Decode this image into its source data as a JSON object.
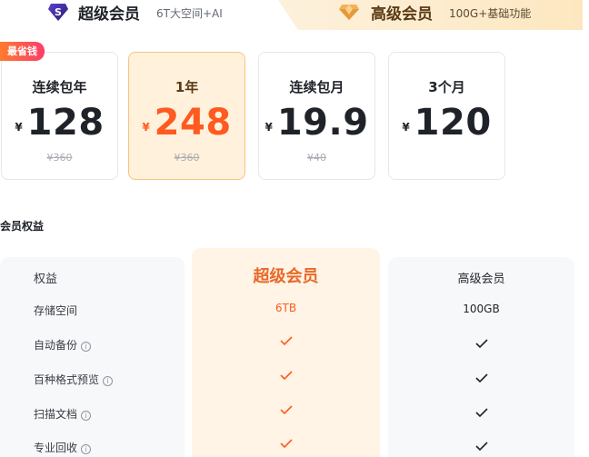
{
  "tabs": {
    "super": {
      "title": "超级会员",
      "subtitle": "6T大空间+AI",
      "icon": "super-member-s-icon"
    },
    "high": {
      "title": "高级会员",
      "subtitle": "100G+基础功能",
      "icon": "diamond-icon"
    }
  },
  "plans": [
    {
      "name": "连续包年",
      "currency": "¥",
      "price": "128",
      "original": "¥360",
      "badge": "最省钱",
      "selected": false
    },
    {
      "name": "1年",
      "currency": "¥",
      "price": "248",
      "original": "¥360",
      "selected": true
    },
    {
      "name": "连续包月",
      "currency": "¥",
      "price": "19.9",
      "original": "¥40",
      "selected": false
    },
    {
      "name": "3个月",
      "currency": "¥",
      "price": "120",
      "original": "",
      "selected": false
    }
  ],
  "benefits": {
    "section_title": "会员权益",
    "header": {
      "label": "权益",
      "super": "超级会员",
      "high": "高级会员"
    },
    "rows": [
      {
        "label": "存储空间",
        "info": false,
        "super": "6TB",
        "high": "100GB"
      },
      {
        "label": "自动备份",
        "info": true,
        "super": "check",
        "high": "check"
      },
      {
        "label": "百种格式预览",
        "info": true,
        "super": "check",
        "high": "check"
      },
      {
        "label": "扫描文档",
        "info": true,
        "super": "check",
        "high": "check"
      },
      {
        "label": "专业回收",
        "info": true,
        "super": "check",
        "high": "check"
      }
    ]
  },
  "colors": {
    "accent": "#ff5a1f",
    "super_header": "#e8692b",
    "selected_bg": "#fff1dc"
  }
}
